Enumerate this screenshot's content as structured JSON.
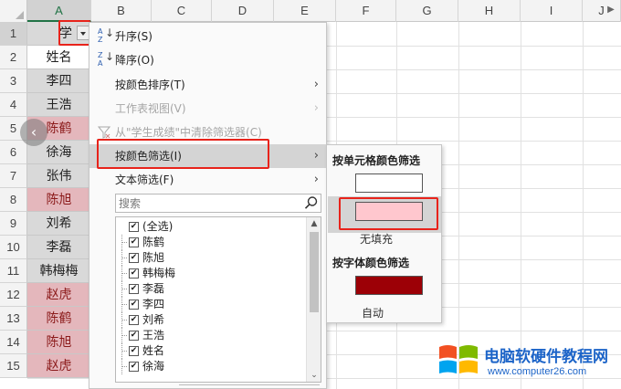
{
  "sheet": {
    "columns": [
      "A",
      "B",
      "C",
      "D",
      "E",
      "F",
      "G",
      "H",
      "I",
      "J"
    ],
    "rows": [
      "1",
      "2",
      "3",
      "4",
      "5",
      "6",
      "7",
      "8",
      "9",
      "10",
      "11",
      "12",
      "13",
      "14",
      "15"
    ],
    "cells_a": [
      "学",
      "姓名",
      "李四",
      "王浩",
      "陈鹤",
      "徐海",
      "张伟",
      "陈旭",
      "刘希",
      "李磊",
      "韩梅梅",
      "赵虎",
      "陈鹤",
      "陈旭",
      "赵虎"
    ],
    "pink_color": "#e4b7bc",
    "header_color": "#d9d9d9"
  },
  "menu": {
    "sort_asc": "升序(S)",
    "sort_desc": "降序(O)",
    "sort_by_color": "按颜色排序(T)",
    "sheet_view": "工作表视图(V)",
    "clear_filter": "从\"学生成绩\"中清除筛选器(C)",
    "filter_by_color": "按颜色筛选(I)",
    "text_filter": "文本筛选(F)",
    "search_placeholder": "搜索",
    "list_items": [
      "(全选)",
      "陈鹤",
      "陈旭",
      "韩梅梅",
      "李磊",
      "李四",
      "刘希",
      "王浩",
      "姓名",
      "徐海"
    ],
    "highlight_color": "#d4d4d4"
  },
  "submenu": {
    "cell_color_title": "按单元格颜色筛选",
    "no_fill": "无填充",
    "font_color_title": "按字体颜色筛选",
    "auto": "自动",
    "swatch_white": "#ffffff",
    "swatch_pink": "#ffc7ce",
    "swatch_darkred": "#9c0006"
  },
  "watermark": {
    "title": "电脑软硬件教程网",
    "url": "www.computer26.com",
    "accent": "#1c64c8"
  },
  "annotation_color": "#e8231b"
}
